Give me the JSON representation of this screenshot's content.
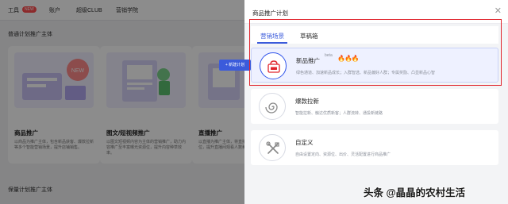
{
  "background": {
    "nav": {
      "items": [
        "工具",
        "账户",
        "超级CLUB",
        "营销学院"
      ],
      "new_badge": "NEW"
    },
    "section_title": "普通计划推广主体",
    "section_title_2": "保量计划推广主体",
    "cards": [
      {
        "title": "商品推广",
        "desc": "以商品为推广主体，包含新品获客、爆款拉新等多个智能营销场景，提升店铺销售。",
        "illus_label": "NEW"
      },
      {
        "title": "图文/短视频推广",
        "desc": "以图文短视频内容为主体的营销推广，助力内容推广至丰富曝光资源位，提升内容种草效率。",
        "illus_label": ""
      },
      {
        "title": "直播推广",
        "desc": "以直播为推广主体，将直播推广至多场景资源位，提升直播间观看人数和成交。",
        "illus_label": ""
      }
    ]
  },
  "drawer": {
    "title": "商品推广计划",
    "close_icon": "close-icon",
    "tabs": [
      {
        "label": "营销场景",
        "active": true
      },
      {
        "label": "草稿箱",
        "active": false
      }
    ],
    "plans": [
      {
        "name": "新品推广",
        "beta": "beta",
        "flames": "🔥🔥🔥",
        "desc": "绿色通道、加速新品成长；入群智选、新品偏好人群；专属奖励、凸显新品心智",
        "icon": "shopping-bag-icon"
      },
      {
        "name": "爆款拉新",
        "desc": "智能拉新、触达优质新客；人群流转、通投新链路",
        "icon": "spiral-icon"
      },
      {
        "name": "自定义",
        "desc": "自由设置定向、资源位、出价、灵活配置进行商品推广",
        "icon": "tools-icon"
      }
    ],
    "create_button": "+ 新建计划"
  },
  "watermark": "头条 @晶晶的农村生活",
  "colors": {
    "accent": "#3b5bdb",
    "highlight_frame": "#e0242c",
    "flame": "#ff5a1f"
  }
}
